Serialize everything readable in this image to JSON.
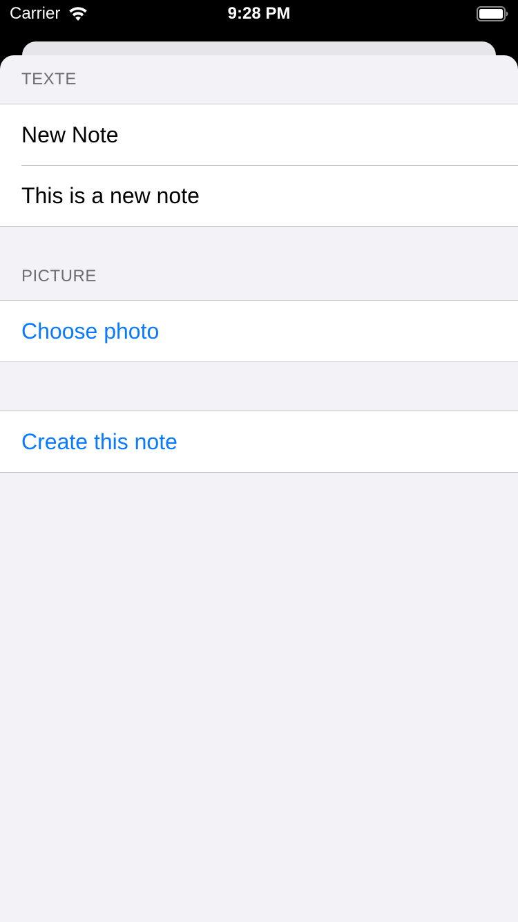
{
  "status_bar": {
    "carrier": "Carrier",
    "time": "9:28 PM",
    "icons": [
      "wifi-icon",
      "battery-icon"
    ]
  },
  "form": {
    "sections": [
      {
        "header": "TEXTE",
        "rows": [
          {
            "value": "New Note"
          },
          {
            "value": "This is a new note"
          }
        ]
      },
      {
        "header": "PICTURE",
        "rows": [
          {
            "label": "Choose photo"
          }
        ]
      },
      {
        "header": "",
        "rows": [
          {
            "label": "Create this note"
          }
        ]
      }
    ]
  },
  "colors": {
    "tint": "#0a7aff",
    "grouped_background": "#f2f2f7",
    "cell_background": "#ffffff",
    "separator": "#c6c6c8",
    "header_text": "#6d6d72"
  }
}
